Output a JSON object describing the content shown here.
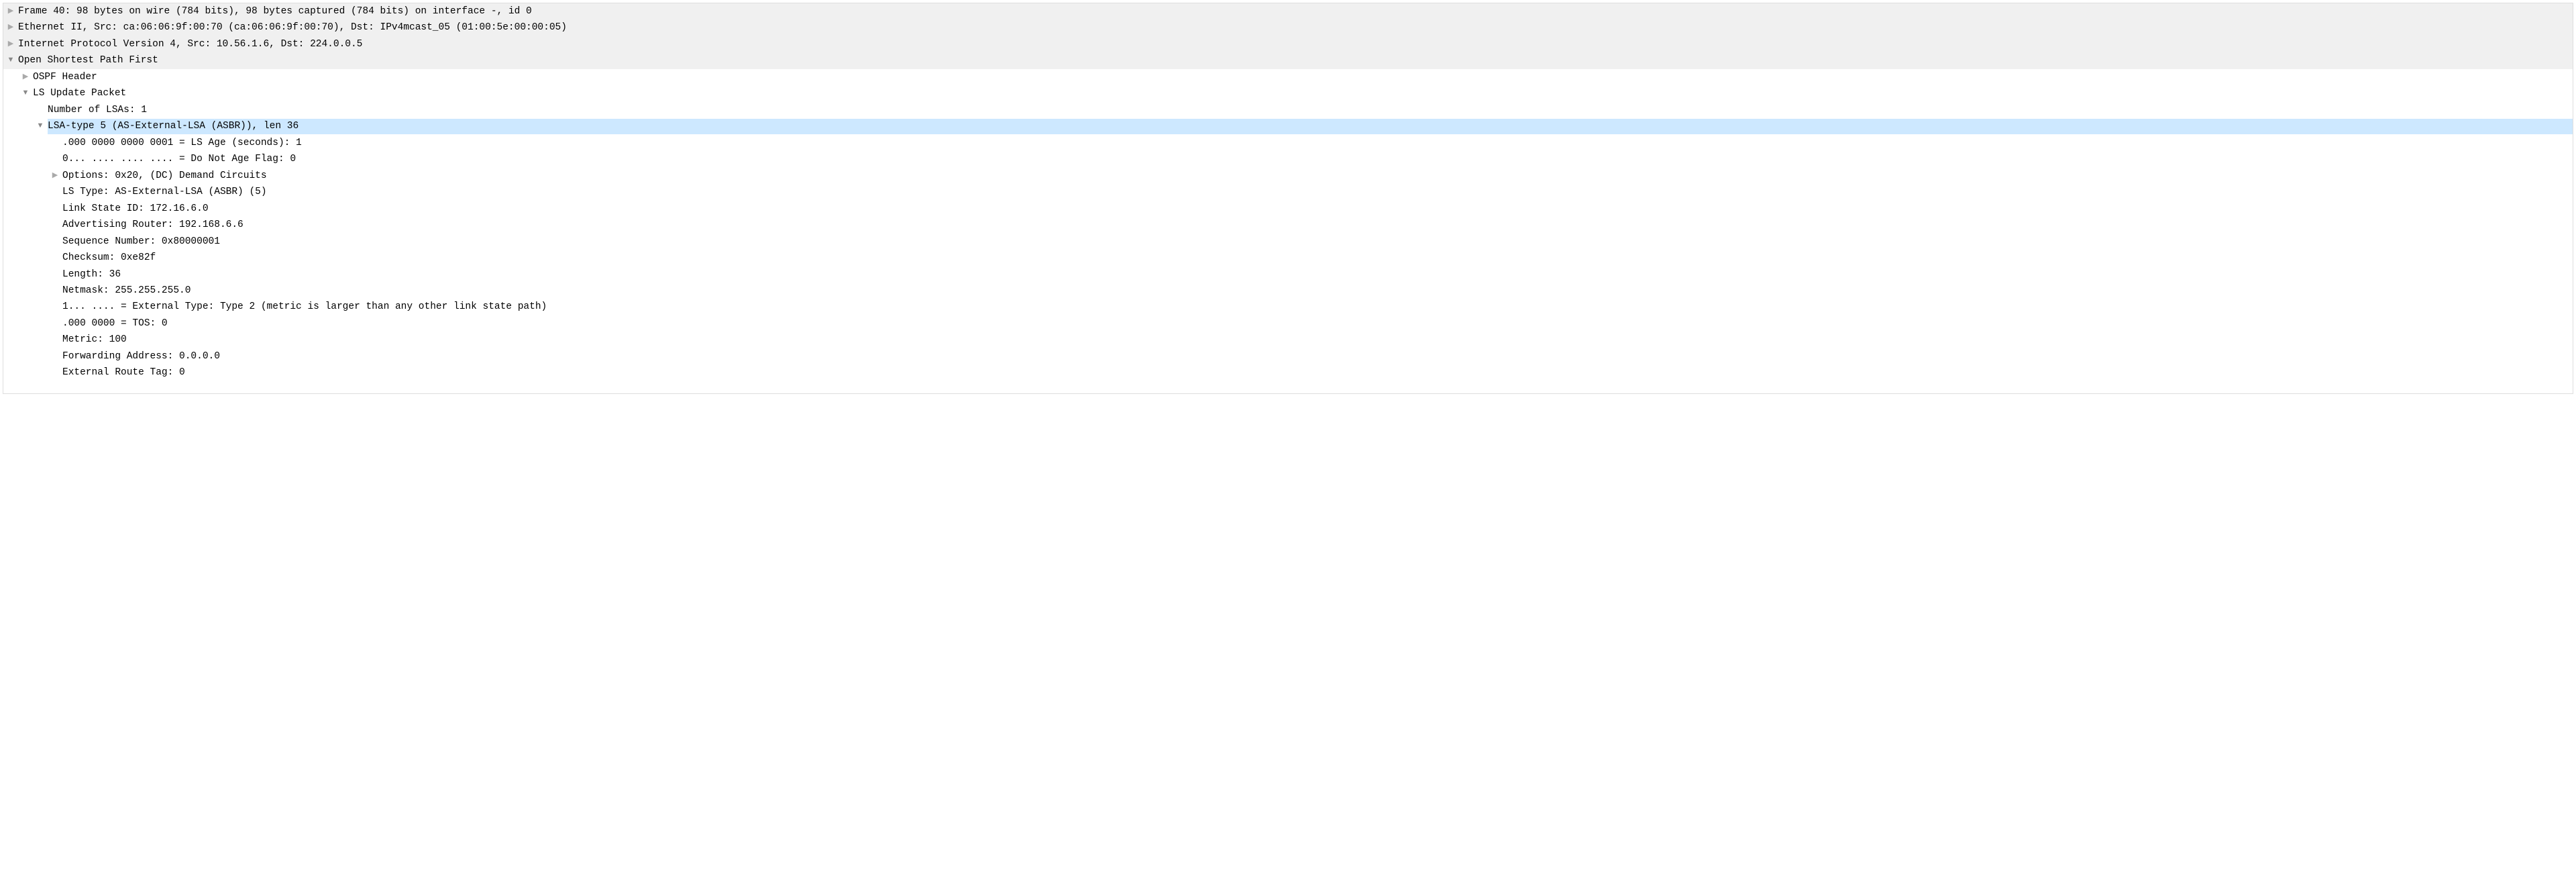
{
  "rows": [
    {
      "indent": 0,
      "caret": "collapsed",
      "bg": "grey",
      "sel": false,
      "interact": true,
      "text": "Frame 40: 98 bytes on wire (784 bits), 98 bytes captured (784 bits) on interface -, id 0"
    },
    {
      "indent": 0,
      "caret": "collapsed",
      "bg": "grey",
      "sel": false,
      "interact": true,
      "text": "Ethernet II, Src: ca:06:06:9f:00:70 (ca:06:06:9f:00:70), Dst: IPv4mcast_05 (01:00:5e:00:00:05)"
    },
    {
      "indent": 0,
      "caret": "collapsed",
      "bg": "grey",
      "sel": false,
      "interact": true,
      "text": "Internet Protocol Version 4, Src: 10.56.1.6, Dst: 224.0.0.5"
    },
    {
      "indent": 0,
      "caret": "expanded",
      "bg": "grey",
      "sel": false,
      "interact": true,
      "text": "Open Shortest Path First"
    },
    {
      "indent": 1,
      "caret": "collapsed",
      "bg": "white",
      "sel": false,
      "interact": true,
      "text": "OSPF Header"
    },
    {
      "indent": 1,
      "caret": "expanded",
      "bg": "white",
      "sel": false,
      "interact": true,
      "text": "LS Update Packet"
    },
    {
      "indent": 2,
      "caret": "none",
      "bg": "white",
      "sel": false,
      "interact": true,
      "text": "Number of LSAs: 1"
    },
    {
      "indent": 2,
      "caret": "expanded",
      "bg": "white",
      "sel": true,
      "interact": true,
      "text": "LSA-type 5 (AS-External-LSA (ASBR)), len 36"
    },
    {
      "indent": 3,
      "caret": "none",
      "bg": "white",
      "sel": false,
      "interact": true,
      "text": ".000 0000 0000 0001 = LS Age (seconds): 1"
    },
    {
      "indent": 3,
      "caret": "none",
      "bg": "white",
      "sel": false,
      "interact": true,
      "text": "0... .... .... .... = Do Not Age Flag: 0"
    },
    {
      "indent": 3,
      "caret": "collapsed",
      "bg": "white",
      "sel": false,
      "interact": true,
      "text": "Options: 0x20, (DC) Demand Circuits"
    },
    {
      "indent": 3,
      "caret": "none",
      "bg": "white",
      "sel": false,
      "interact": true,
      "text": "LS Type: AS-External-LSA (ASBR) (5)"
    },
    {
      "indent": 3,
      "caret": "none",
      "bg": "white",
      "sel": false,
      "interact": true,
      "text": "Link State ID: 172.16.6.0"
    },
    {
      "indent": 3,
      "caret": "none",
      "bg": "white",
      "sel": false,
      "interact": true,
      "text": "Advertising Router: 192.168.6.6"
    },
    {
      "indent": 3,
      "caret": "none",
      "bg": "white",
      "sel": false,
      "interact": true,
      "text": "Sequence Number: 0x80000001"
    },
    {
      "indent": 3,
      "caret": "none",
      "bg": "white",
      "sel": false,
      "interact": true,
      "text": "Checksum: 0xe82f"
    },
    {
      "indent": 3,
      "caret": "none",
      "bg": "white",
      "sel": false,
      "interact": true,
      "text": "Length: 36"
    },
    {
      "indent": 3,
      "caret": "none",
      "bg": "white",
      "sel": false,
      "interact": true,
      "text": "Netmask: 255.255.255.0"
    },
    {
      "indent": 3,
      "caret": "none",
      "bg": "white",
      "sel": false,
      "interact": true,
      "text": "1... .... = External Type: Type 2 (metric is larger than any other link state path)"
    },
    {
      "indent": 3,
      "caret": "none",
      "bg": "white",
      "sel": false,
      "interact": true,
      "text": ".000 0000 = TOS: 0"
    },
    {
      "indent": 3,
      "caret": "none",
      "bg": "white",
      "sel": false,
      "interact": true,
      "text": "Metric: 100"
    },
    {
      "indent": 3,
      "caret": "none",
      "bg": "white",
      "sel": false,
      "interact": true,
      "text": "Forwarding Address: 0.0.0.0"
    },
    {
      "indent": 3,
      "caret": "none",
      "bg": "white",
      "sel": false,
      "interact": true,
      "text": "External Route Tag: 0"
    }
  ]
}
